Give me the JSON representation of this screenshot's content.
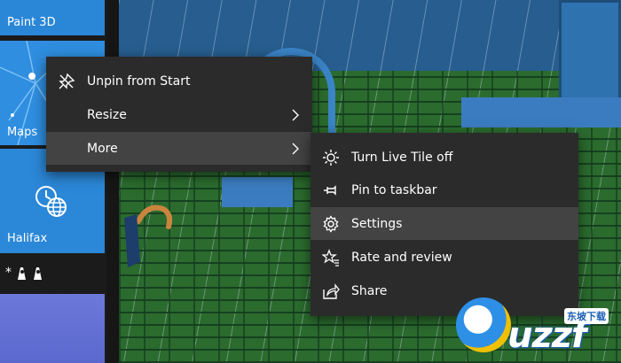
{
  "tiles": {
    "paint3d": {
      "label": "Paint 3D",
      "color": "#2a86d6"
    },
    "maps": {
      "label": "Maps",
      "color": "#2f8ee0"
    },
    "halifax": {
      "label": "Halifax",
      "color": "#2b87d7"
    },
    "people_row": {
      "star": "*"
    }
  },
  "context_menu": {
    "items": [
      {
        "label": "Unpin from Start",
        "icon": "unpin-icon"
      },
      {
        "label": "Resize",
        "icon": "",
        "has_submenu": true
      },
      {
        "label": "More",
        "icon": "",
        "has_submenu": true,
        "highlighted": true
      }
    ]
  },
  "submenu": {
    "items": [
      {
        "label": "Turn Live Tile off",
        "icon": "live-tile-icon"
      },
      {
        "label": "Pin to taskbar",
        "icon": "pin-icon"
      },
      {
        "label": "Settings",
        "icon": "gear-icon",
        "highlighted": true
      },
      {
        "label": "Rate and review",
        "icon": "rate-review-icon"
      },
      {
        "label": "Share",
        "icon": "share-icon"
      }
    ]
  },
  "watermark": {
    "site": "uzzf",
    "tagline": "东坡下载"
  },
  "colors": {
    "menu_bg": "#2b2b2b",
    "menu_highlight": "#434343",
    "accent": "#2a86d6"
  }
}
